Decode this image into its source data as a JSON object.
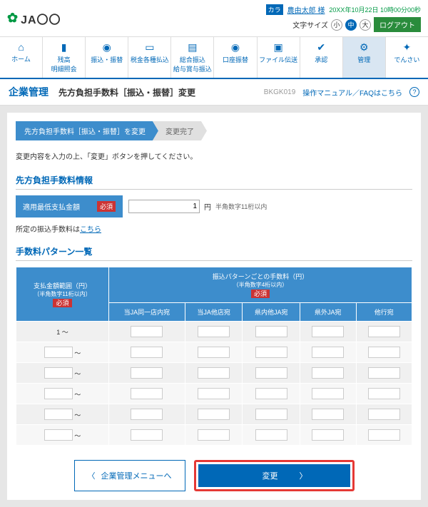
{
  "header": {
    "logo_text": "JA〇〇",
    "icon_label": "カラ",
    "user": "農由太郎 様",
    "datetime": "20XX年10月22日 10時00分00秒",
    "font_label": "文字サイズ",
    "font_s": "小",
    "font_m": "中",
    "font_l": "大",
    "logout": "ログアウト"
  },
  "nav": [
    {
      "label": "ホーム"
    },
    {
      "label": "残高\n明細照会"
    },
    {
      "label": "振込・振替"
    },
    {
      "label": "税金各種払込"
    },
    {
      "label": "総合振込\n給与賞与振込"
    },
    {
      "label": "口座振替"
    },
    {
      "label": "ファイル伝送"
    },
    {
      "label": "承認"
    },
    {
      "label": "管理"
    },
    {
      "label": "でんさい"
    }
  ],
  "title": {
    "main": "企業管理",
    "sub": "先方負担手数料［振込・振替］変更",
    "id": "BKGK019",
    "faq": "操作マニュアル／FAQはこちら"
  },
  "steps": {
    "active": "先方負担手数料［振込・振替］を変更",
    "inactive": "変更完了"
  },
  "instruction": "変更内容を入力の上、「変更」ボタンを押してください。",
  "section1": {
    "title": "先方負担手数料情報",
    "label": "適用最低支払金額",
    "req": "必須",
    "value": "1",
    "unit": "円",
    "note": "半角数字11桁以内",
    "link_pre": "所定の振込手数料は",
    "link": "こちら"
  },
  "section2": {
    "title": "手数料パターン一覧",
    "th_range": "支払金額範囲（円）",
    "th_range_note": "（半角数字11桁以内）",
    "th_pattern": "振込パターンごとの手数料（円）",
    "th_pattern_note": "（半角数字4桁以内）",
    "req": "必須",
    "cols": [
      "当JA同一店内宛",
      "当JA他店宛",
      "県内他JA宛",
      "県外JA宛",
      "他行宛"
    ],
    "rows": [
      {
        "from": "1",
        "sep": "～"
      },
      {
        "from": "",
        "sep": "～"
      },
      {
        "from": "",
        "sep": "～"
      },
      {
        "from": "",
        "sep": "～"
      },
      {
        "from": "",
        "sep": "～"
      },
      {
        "from": "",
        "sep": "～"
      }
    ]
  },
  "buttons": {
    "back": "企業管理メニューへ",
    "change": "変更"
  }
}
